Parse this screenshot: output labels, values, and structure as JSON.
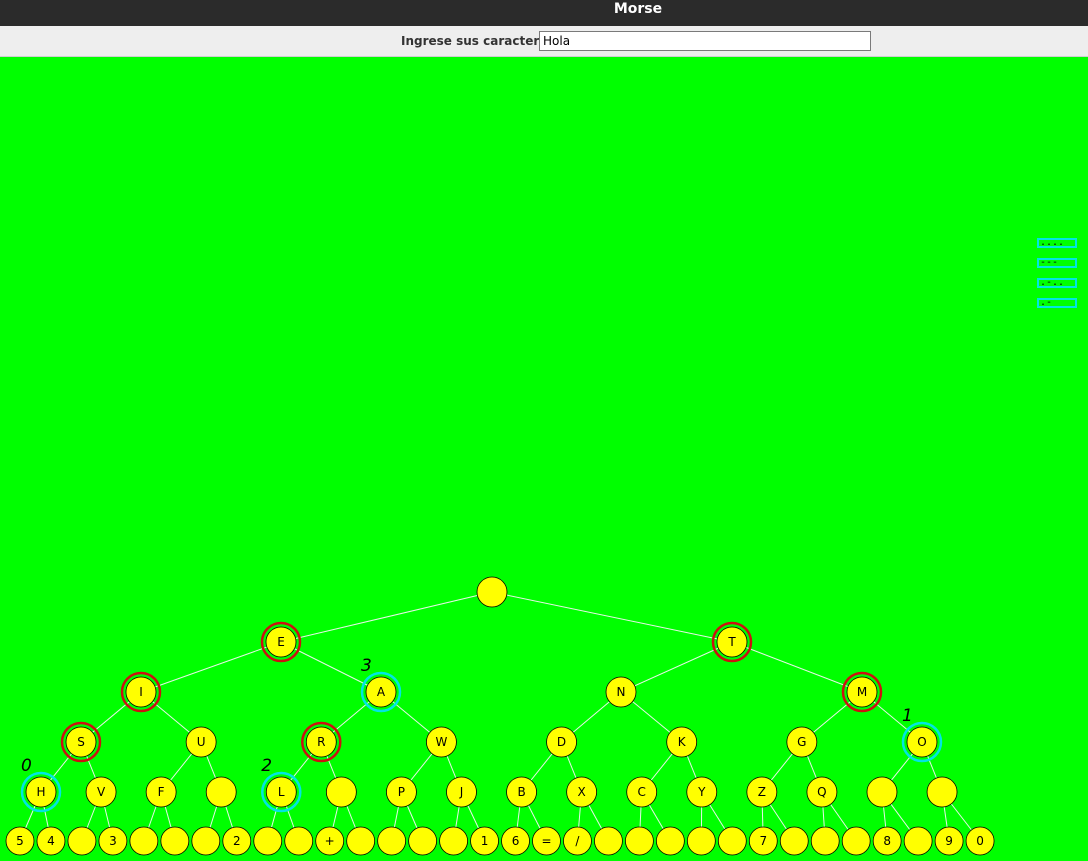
{
  "window": {
    "title": "Morse"
  },
  "input": {
    "label": "Ingrese sus caracteres",
    "value": "Hola"
  },
  "morse_outputs": [
    "....",
    "---",
    ".-..",
    ".-"
  ],
  "colors": {
    "background": "#00ff00",
    "node_fill": "#ffff00",
    "path_ring": "#cc1111",
    "target_ring": "#00e5e5",
    "edge": "#e8f5e8"
  },
  "tree": {
    "levels": [
      [
        ""
      ],
      [
        "E",
        "T"
      ],
      [
        "I",
        "A",
        "N",
        "M"
      ],
      [
        "S",
        "U",
        "R",
        "W",
        "D",
        "K",
        "G",
        "O"
      ],
      [
        "H",
        "V",
        "F",
        "",
        "L",
        "",
        "P",
        "J",
        "B",
        "X",
        "C",
        "Y",
        "Z",
        "Q",
        "",
        ""
      ],
      [
        "5",
        "4",
        "",
        "3",
        "",
        "",
        "",
        "2",
        "",
        "",
        "+",
        "",
        "",
        "",
        "",
        "1",
        "6",
        "=",
        "/",
        "",
        "",
        "",
        "",
        "",
        "7",
        "",
        "",
        "",
        "8",
        "",
        "9",
        "0"
      ]
    ],
    "path_nodes": [
      "E",
      "T",
      "I",
      "M",
      "S",
      "R"
    ],
    "targets": [
      {
        "letter": "H",
        "order": "0"
      },
      {
        "letter": "O",
        "order": "1"
      },
      {
        "letter": "L",
        "order": "2"
      },
      {
        "letter": "A",
        "order": "3"
      }
    ]
  }
}
